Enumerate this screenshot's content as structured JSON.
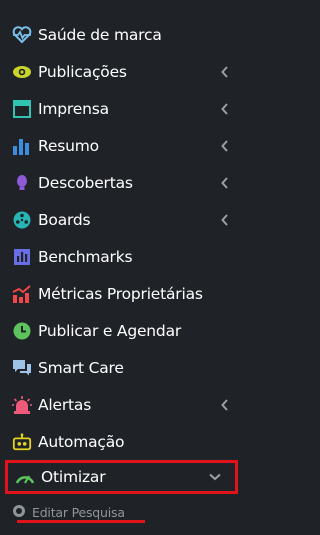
{
  "menu": {
    "items": [
      {
        "label": "Saúde de marca",
        "icon": "heart-pulse-icon",
        "color": "#7bbfe8",
        "chevron": ""
      },
      {
        "label": "Publicações",
        "icon": "eye-icon",
        "color": "#c8d42a",
        "chevron": "left"
      },
      {
        "label": "Imprensa",
        "icon": "newspaper-icon",
        "color": "#2fc4b2",
        "chevron": "left"
      },
      {
        "label": "Resumo",
        "icon": "bar-chart-icon",
        "color": "#3c8dde",
        "chevron": "left"
      },
      {
        "label": "Descobertas",
        "icon": "lightbulb-icon",
        "color": "#8e5ad8",
        "chevron": "left"
      },
      {
        "label": "Boards",
        "icon": "boards-icon",
        "color": "#28b5b5",
        "chevron": "left"
      },
      {
        "label": "Benchmarks",
        "icon": "benchmark-chart-icon",
        "color": "#6a6ee6",
        "chevron": ""
      },
      {
        "label": "Métricas Proprietárias",
        "icon": "metrics-chart-icon",
        "color": "#f0474a",
        "chevron": ""
      },
      {
        "label": "Publicar e Agendar",
        "icon": "clock-icon",
        "color": "#5cc35c",
        "chevron": ""
      },
      {
        "label": "Smart Care",
        "icon": "chat-icon",
        "color": "#9fc3e6",
        "chevron": ""
      },
      {
        "label": "Alertas",
        "icon": "siren-icon",
        "color": "#f05a7a",
        "chevron": "left"
      },
      {
        "label": "Automação",
        "icon": "robot-icon",
        "color": "#e3d21e",
        "chevron": ""
      },
      {
        "label": "Otimizar",
        "icon": "gauge-icon",
        "color": "#5cc35c",
        "chevron": "down"
      }
    ],
    "sub": {
      "label": "Editar Pesquisa",
      "icon": "circle-dot-icon"
    }
  },
  "colors": {
    "background": "#1f2327",
    "highlight": "#e0131a",
    "chevron": "#9aa0a6",
    "sub_text": "#8e969c"
  }
}
